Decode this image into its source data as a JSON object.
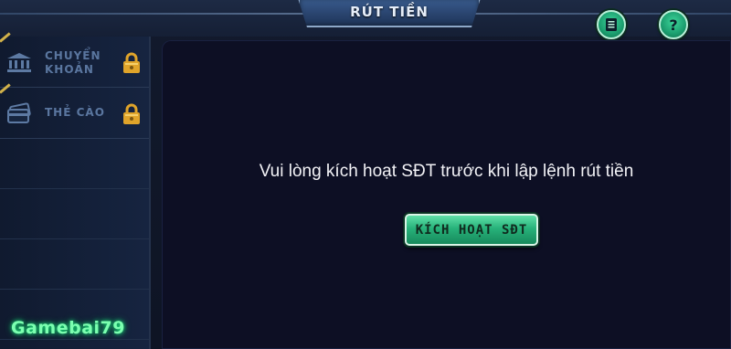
{
  "header": {
    "title": "RÚT TIỀN",
    "history_icon": "document-list-icon",
    "help_icon": "question-mark-icon",
    "help_glyph": "?"
  },
  "sidebar": {
    "items": [
      {
        "label_line1": "CHUYỂN",
        "label_line2": "KHOẢN",
        "icon": "bank-icon",
        "locked": true
      },
      {
        "label_line1": "THẺ CÀO",
        "label_line2": "",
        "icon": "card-icon",
        "locked": true
      }
    ]
  },
  "main": {
    "message": "Vui lòng kích hoạt SĐT trước khi lập lệnh rút tiền",
    "activate_button": "KÍCH HOẠT SĐT"
  },
  "watermark": "Gamebai79",
  "colors": {
    "accent_green": "#27b27a",
    "panel_bg": "#0d0f24",
    "sidebar_text": "#5a769f",
    "lock_gold": "#e0a42a"
  }
}
